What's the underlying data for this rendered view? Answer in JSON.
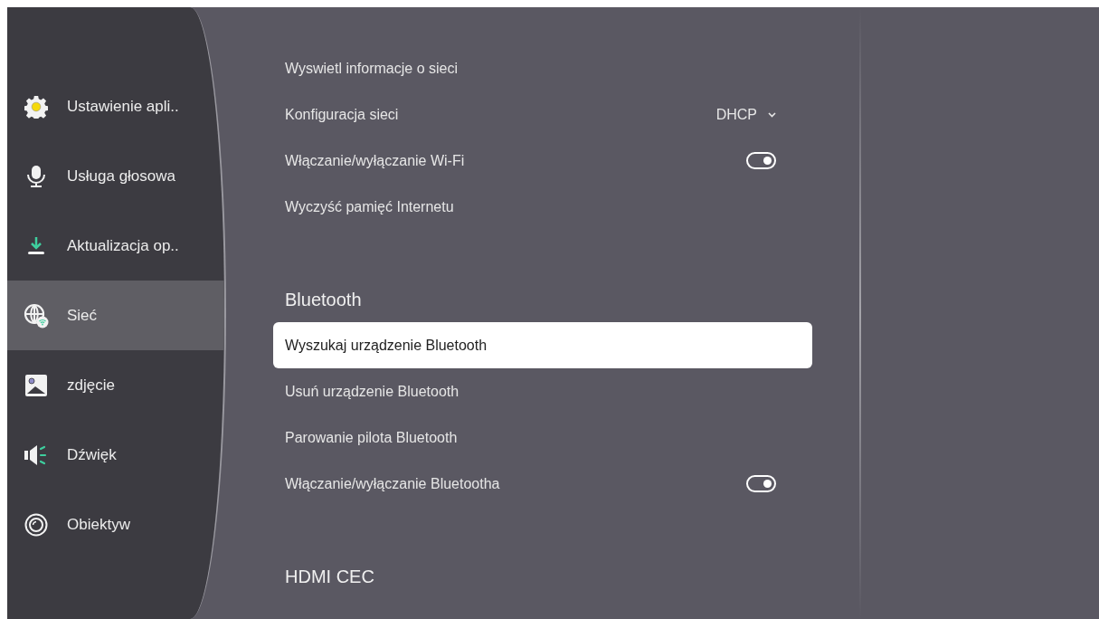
{
  "sidebar": {
    "items": [
      {
        "label": "Ustawienie apli..",
        "kind": "gear",
        "selected": false
      },
      {
        "label": "Usługa głosowa",
        "kind": "mic",
        "selected": false
      },
      {
        "label": "Aktualizacja op..",
        "kind": "download",
        "selected": false
      },
      {
        "label": "Sieć",
        "kind": "network",
        "selected": true
      },
      {
        "label": "zdjęcie",
        "kind": "picture",
        "selected": false
      },
      {
        "label": "Dźwięk",
        "kind": "sound",
        "selected": false
      },
      {
        "label": "Obiektyw",
        "kind": "lens",
        "selected": false
      }
    ]
  },
  "settings": [
    {
      "kind": "row",
      "label": "Wyswietl informacje o sieci",
      "selected": false
    },
    {
      "kind": "dropdown",
      "label": "Konfiguracja sieci",
      "value": "DHCP",
      "selected": false
    },
    {
      "kind": "toggle",
      "label": "Włączanie/wyłączanie Wi-Fi",
      "on": true,
      "selected": false
    },
    {
      "kind": "row",
      "label": "Wyczyść pamięć Internetu",
      "selected": false
    },
    {
      "kind": "header",
      "label": "Bluetooth"
    },
    {
      "kind": "row",
      "label": "Wyszukaj urządzenie Bluetooth",
      "selected": true
    },
    {
      "kind": "row",
      "label": "Usuń urządzenie Bluetooth",
      "selected": false
    },
    {
      "kind": "row",
      "label": "Parowanie pilota Bluetooth",
      "selected": false
    },
    {
      "kind": "toggle",
      "label": "Włączanie/wyłączanie Bluetootha",
      "on": true,
      "selected": false
    },
    {
      "kind": "header",
      "label": "HDMI CEC"
    }
  ]
}
